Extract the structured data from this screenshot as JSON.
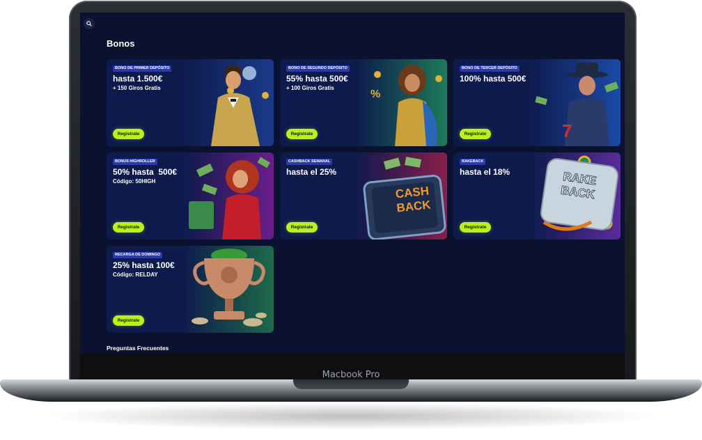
{
  "device": {
    "brand_label": "Macbook Pro"
  },
  "header": {
    "search_icon": "search-icon"
  },
  "page": {
    "title": "Bonos",
    "faq_title": "Preguntas Frecuentes"
  },
  "colors": {
    "background": "#0b1230",
    "card": "#0e1a4a",
    "cta": "#b8f21a",
    "badge": "#2a3aa8"
  },
  "bonuses": [
    {
      "badge": "Bono de primer depósito",
      "headline": "hasta 1.500€",
      "subline": "+ 150 Giros Gratis",
      "cta": "Registrate",
      "art": "gentleman-diamond-illustration"
    },
    {
      "badge": "Bono de segundo depósito",
      "headline": "55% hasta 500€",
      "subline": "+ 100 Giros Gratis",
      "cta": "Registrate",
      "art": "woman-gold-dress-illustration"
    },
    {
      "badge": "Bono de tercer depósito",
      "headline": "100% hasta 500€",
      "subline": "",
      "cta": "Registrate",
      "art": "man-hat-seven-illustration"
    },
    {
      "badge": "Bonus Highroller",
      "headline": "50% hasta  500€",
      "subline": "Código: 50HIGH",
      "cta": "Registrate",
      "art": "woman-red-cash-illustration"
    },
    {
      "badge": "Cashback semanal",
      "headline": "hasta el 25%",
      "subline": "",
      "cta": "Registrate",
      "art": "cash-back-sign-illustration"
    },
    {
      "badge": "Rakeback",
      "headline": "hasta el 18%",
      "subline": "",
      "cta": "Registrate",
      "art": "rake-back-sign-illustration"
    },
    {
      "badge": "Recarga de domingo",
      "headline": "25% hasta 100€",
      "subline": "Código: RELDAY",
      "cta": "Registrate",
      "art": "trophy-coins-illustration"
    }
  ]
}
